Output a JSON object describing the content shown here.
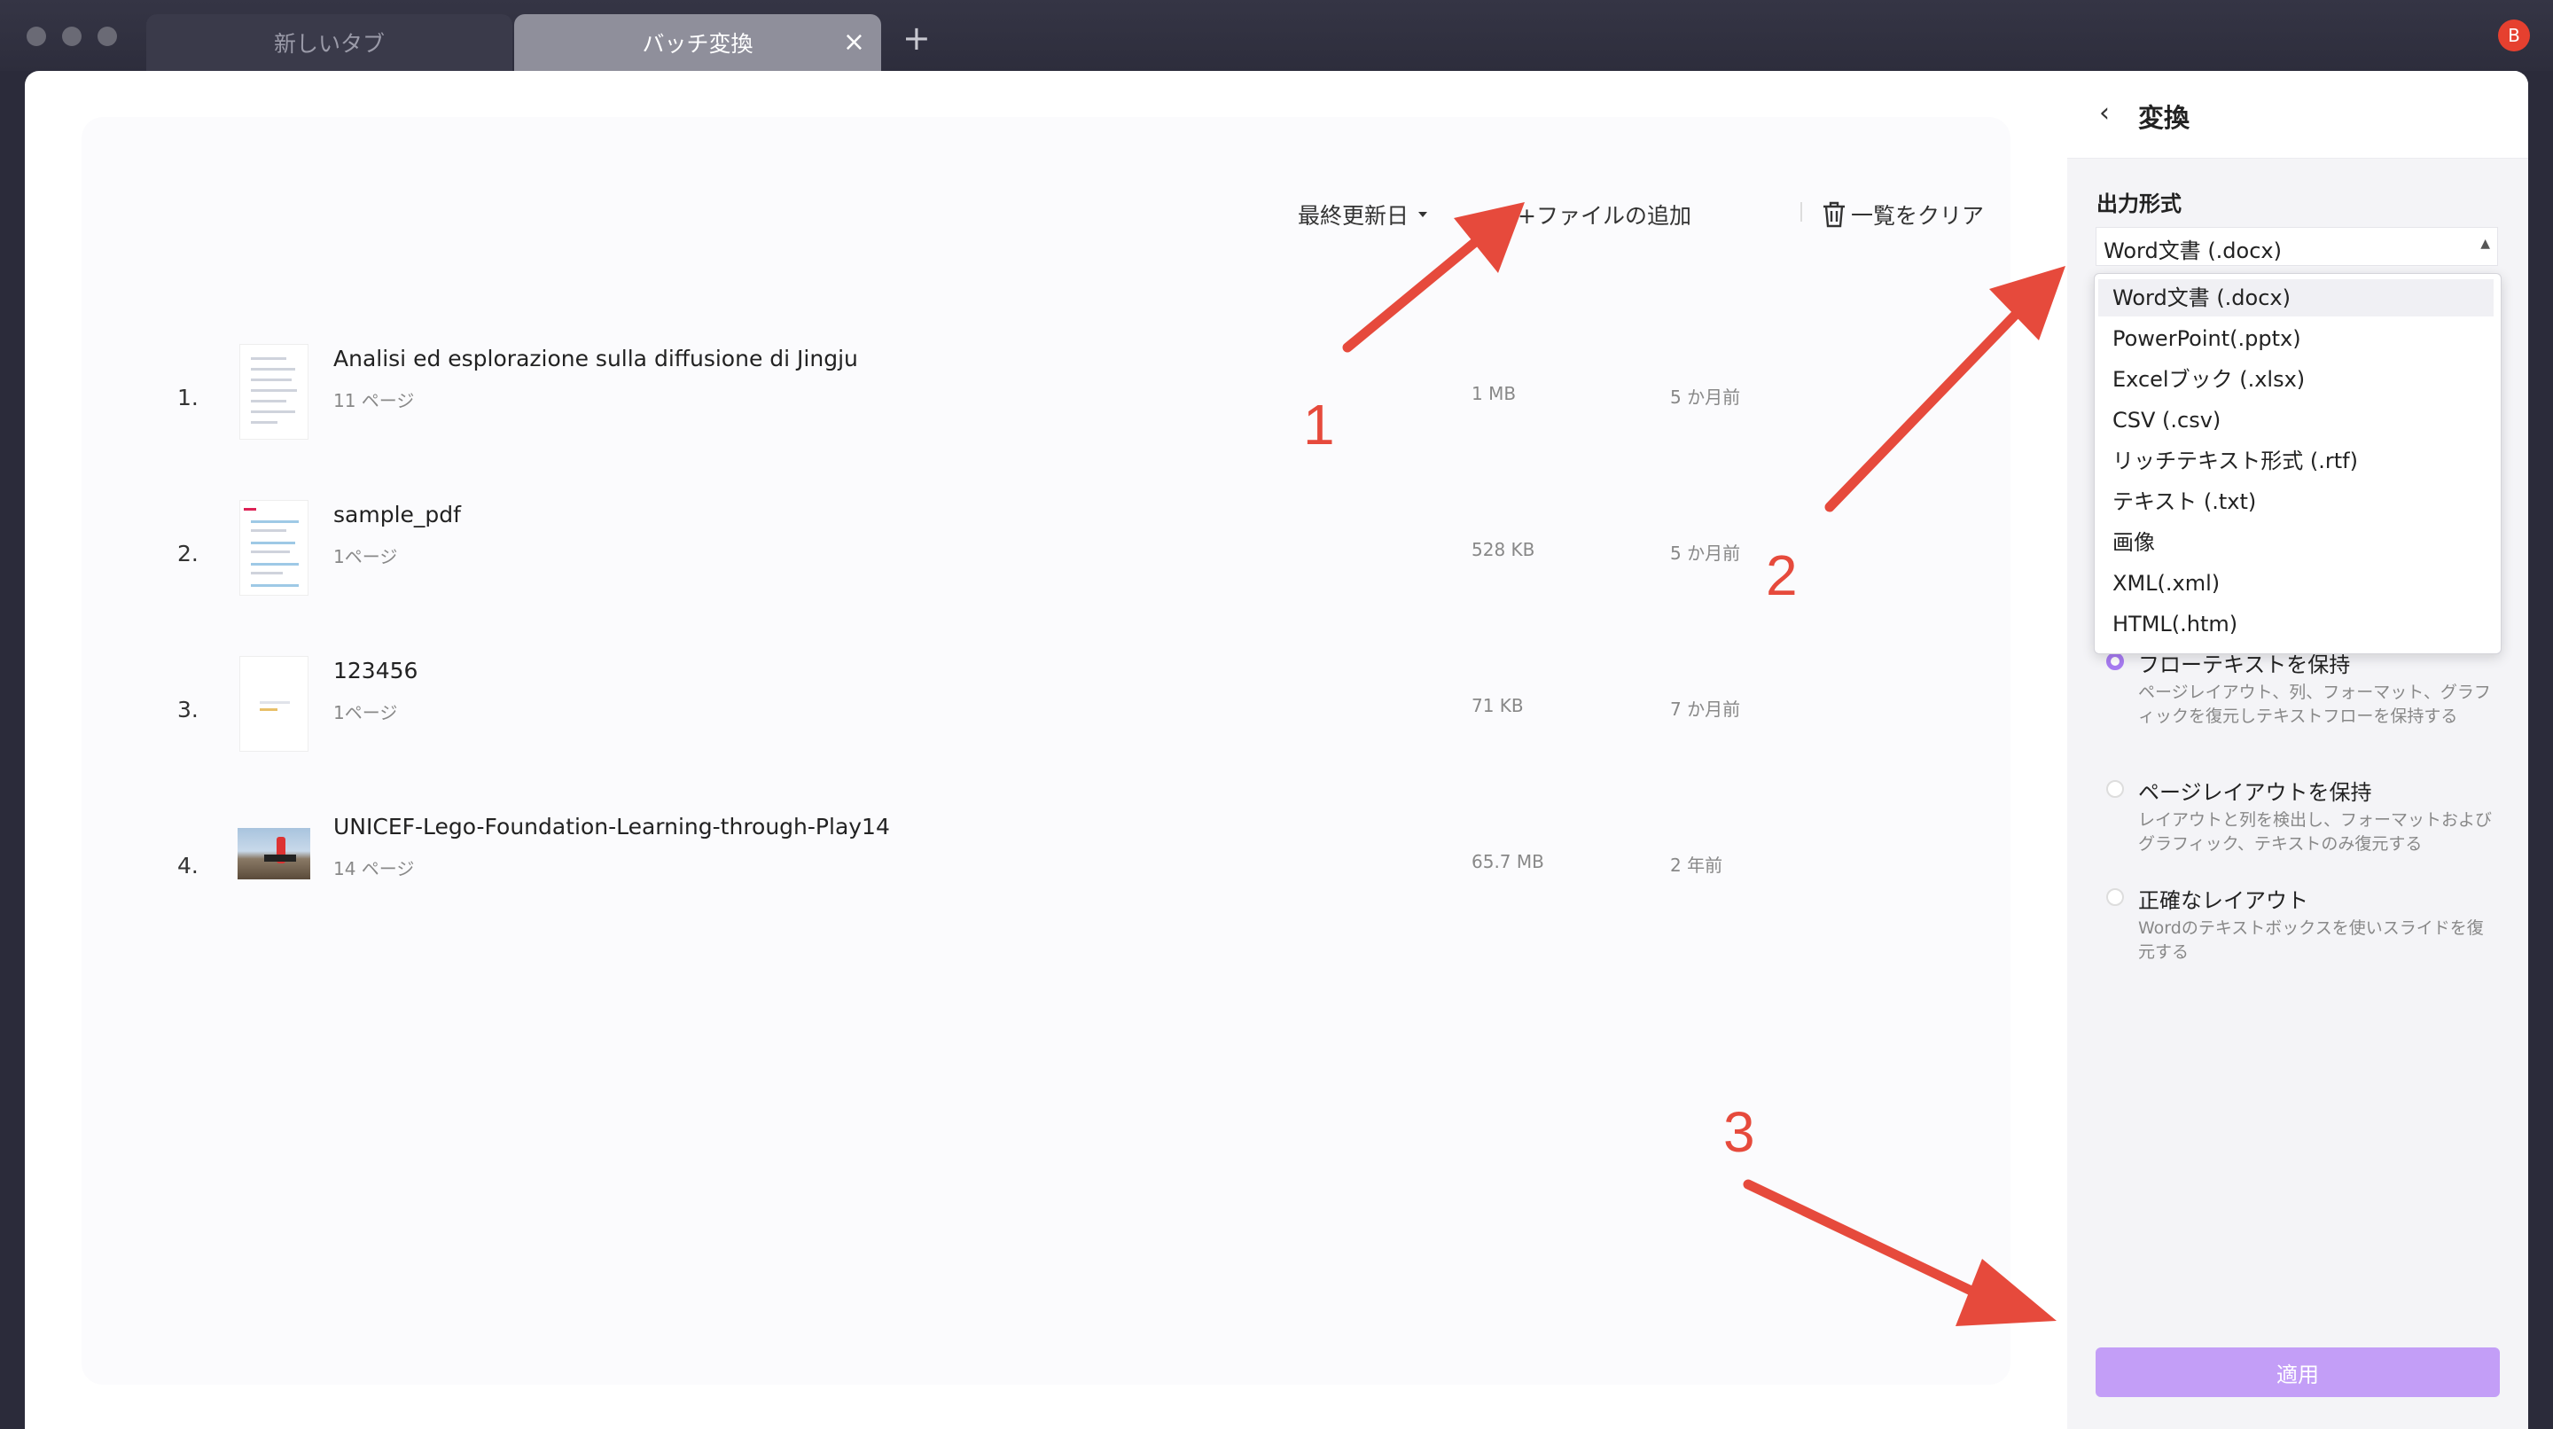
{
  "tabs": [
    {
      "label": "新しいタブ",
      "active": false
    },
    {
      "label": "バッチ変換",
      "active": true
    }
  ],
  "tab_close_icon": "×",
  "tab_add_icon": "+",
  "avatar_letter": "B",
  "toolbar": {
    "sort_label": "最終更新日",
    "add_file_label": "+ファイルの追加",
    "clear_label": "一覧をクリア"
  },
  "files": [
    {
      "num": "1.",
      "name": "Analisi ed esplorazione sulla diffusione di Jingju",
      "pages": "11 ページ",
      "size": "1 MB",
      "date": "5 か月前"
    },
    {
      "num": "2.",
      "name": "sample_pdf",
      "pages": "1ページ",
      "size": "528 KB",
      "date": "5 か月前"
    },
    {
      "num": "3.",
      "name": "123456",
      "pages": "1ページ",
      "size": "71 KB",
      "date": "7 か月前"
    },
    {
      "num": "4.",
      "name": "UNICEF-Lego-Foundation-Learning-through-Play14",
      "pages": "14 ページ",
      "size": "65.7 MB",
      "date": "2 年前"
    }
  ],
  "panel": {
    "title": "変換",
    "output_format_label": "出力形式",
    "selected_format": "Word文書 (.docx)",
    "format_options": [
      "Word文書 (.docx)",
      "PowerPoint(.pptx)",
      "Excelブック (.xlsx)",
      "CSV (.csv)",
      "リッチテキスト形式 (.rtf)",
      "テキスト (.txt)",
      "画像",
      "XML(.xml)",
      "HTML(.htm)"
    ],
    "layout_options": [
      {
        "title": "フローテキストを保持",
        "desc": "ページレイアウト、列、フォーマット、グラフィックを復元しテキストフローを保持する",
        "checked": true
      },
      {
        "title": "ページレイアウトを保持",
        "desc": "レイアウトと列を検出し、フォーマットおよびグラフィック、テキストのみ復元する",
        "checked": false
      },
      {
        "title": "正確なレイアウト",
        "desc": "Wordのテキストボックスを使いスライドを復元する",
        "checked": false
      }
    ],
    "apply_label": "適用"
  },
  "annotations": [
    "1",
    "2",
    "3"
  ],
  "colors": {
    "accent": "#a77bf2",
    "apply_button": "#c39ef7",
    "annotation": "#e64a3c"
  }
}
